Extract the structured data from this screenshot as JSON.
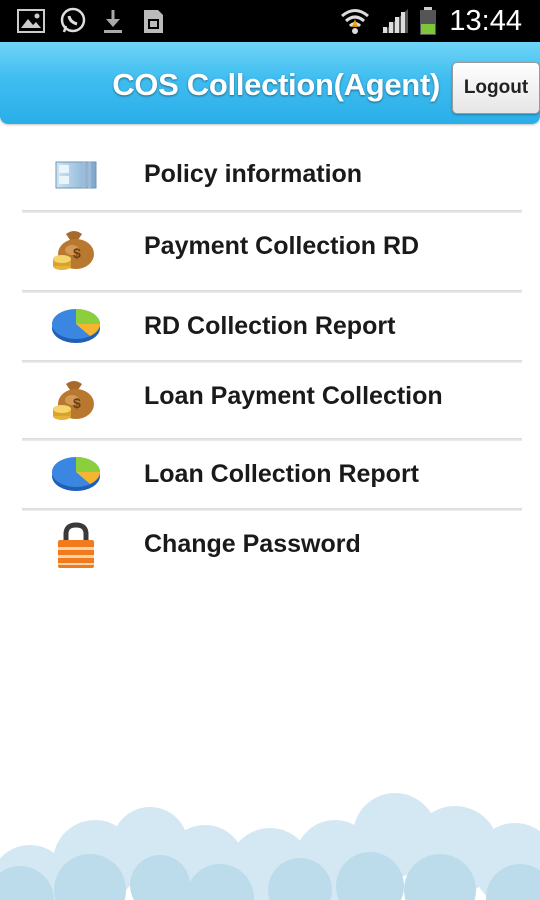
{
  "status_bar": {
    "time": "13:44",
    "icons": [
      "image-icon",
      "whatsapp-icon",
      "download-icon",
      "sd-card-icon",
      "wifi-icon",
      "signal-icon",
      "battery-icon"
    ]
  },
  "header": {
    "title": "COS Collection(Agent)",
    "logout_label": "Logout",
    "accent": "#3fbdf0"
  },
  "menu": {
    "items": [
      {
        "label": "Policy information",
        "icon": "policy-info-icon"
      },
      {
        "label": "Payment Collection RD",
        "icon": "money-bag-icon"
      },
      {
        "label": "RD Collection Report",
        "icon": "pie-chart-icon"
      },
      {
        "label": "Loan Payment Collection",
        "icon": "money-bag-icon"
      },
      {
        "label": "Loan Collection Report",
        "icon": "pie-chart-icon"
      },
      {
        "label": "Change Password",
        "icon": "lock-icon"
      }
    ]
  }
}
